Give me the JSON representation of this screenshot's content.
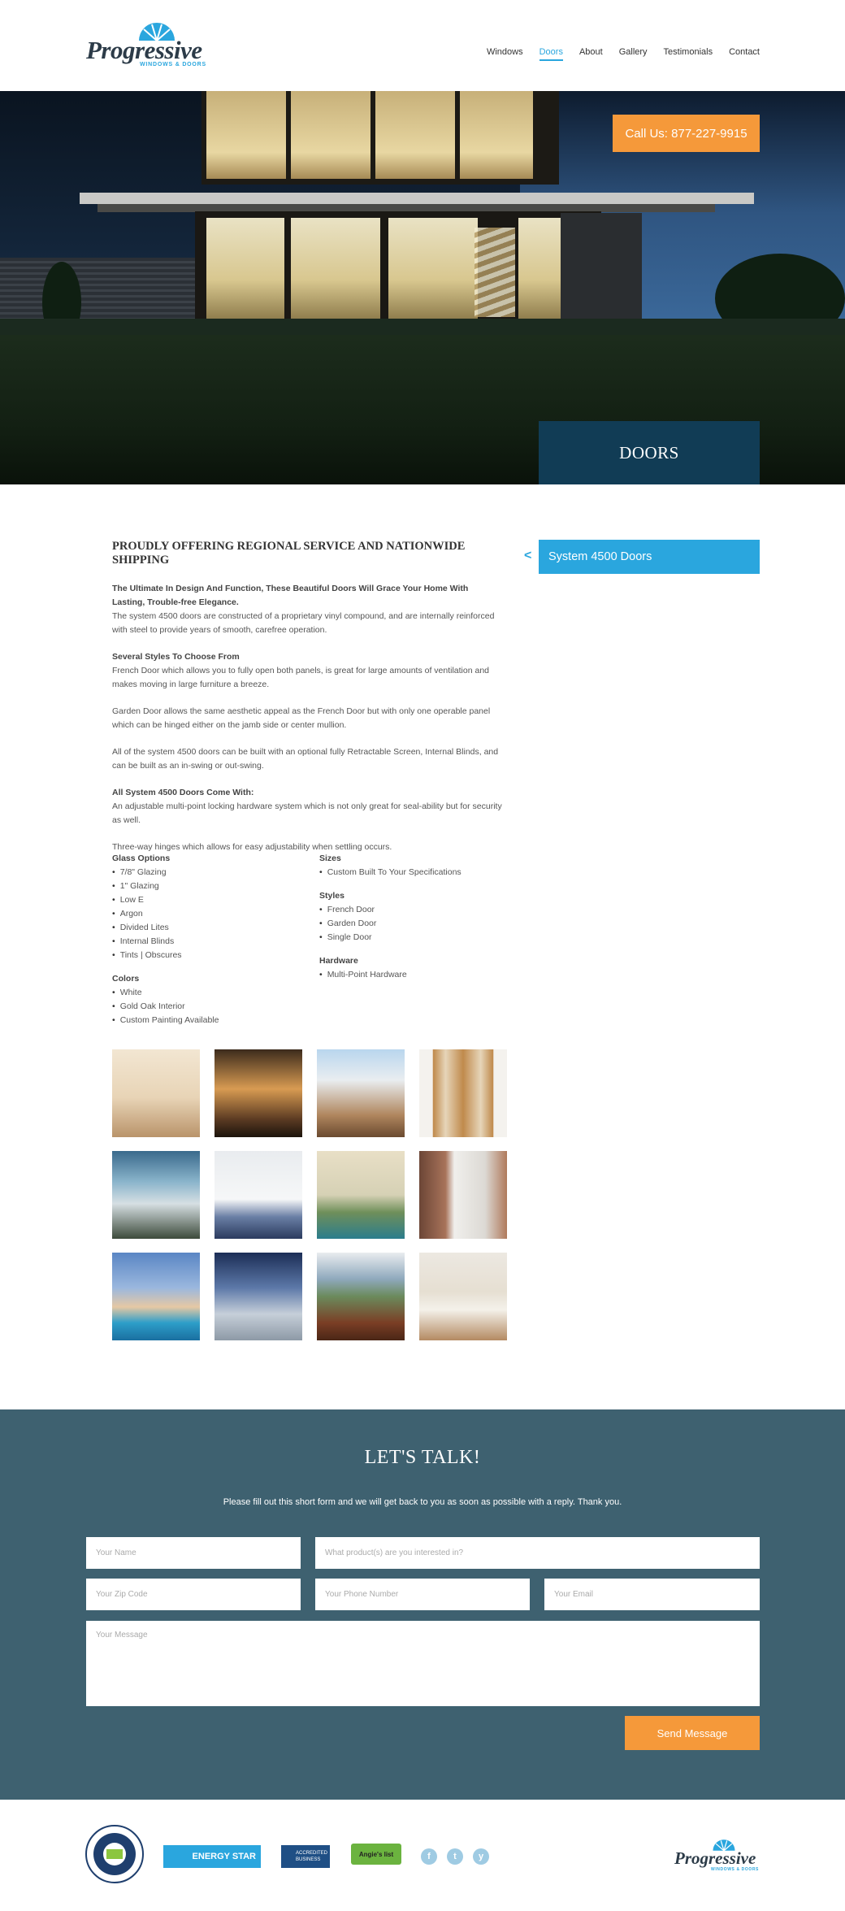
{
  "header": {
    "logo_text": "Progressive",
    "logo_sub": "WINDOWS & DOORS",
    "nav": [
      "Windows",
      "Doors",
      "About",
      "Gallery",
      "Testimonials",
      "Contact"
    ],
    "active_nav": "Doors"
  },
  "hero": {
    "cta": "Call Us: 877-227-9915",
    "page_label": "DOORS"
  },
  "sidebar": {
    "back_icon": "<",
    "item": "System 4500 Doors"
  },
  "content": {
    "title": "PROUDLY OFFERING REGIONAL SERVICE AND NATIONWIDE SHIPPING",
    "p1_bold": "The Ultimate In Design And Function, These Beautiful Doors Will Grace Your Home With Lasting, Trouble-free Elegance.",
    "p1_text": "The system 4500 doors are constructed of a proprietary vinyl compound, and are internally reinforced with steel to provide years of smooth, carefree operation.",
    "p2_bold": "Several Styles To Choose From",
    "p2_text": "French Door which allows you to fully open both panels, is great for large amounts of ventilation and makes moving in large furniture a breeze.",
    "p3_text": "Garden Door allows the same aesthetic appeal as the French Door but with only one operable panel which can be hinged either on the jamb side or center mullion.",
    "p4_text": "All of the system 4500 doors can be built with an optional fully Retractable Screen, Internal Blinds, and can be built as an in-swing or out-swing.",
    "p5_bold": "All System 4500 Doors Come With:",
    "p5_text": "An adjustable multi-point locking hardware system which is not only great for seal-ability but for security as well.",
    "p6_text": "Three-way hinges which allows for easy adjustability when settling occurs."
  },
  "specs": {
    "glass": {
      "heading": "Glass Options",
      "items": [
        "7/8\" Glazing",
        "1\" Glazing",
        "Low E",
        "Argon",
        "Divided Lites",
        "Internal Blinds",
        "Tints | Obscures"
      ]
    },
    "colors": {
      "heading": "Colors",
      "items": [
        "White",
        "Gold Oak Interior",
        "Custom Painting Available"
      ]
    },
    "sizes": {
      "heading": "Sizes",
      "items": [
        "Custom Built To Your Specifications"
      ]
    },
    "styles": {
      "heading": "Styles",
      "items": [
        "French Door",
        "Garden Door",
        "Single Door"
      ]
    },
    "hardware": {
      "heading": "Hardware",
      "items": [
        "Multi-Point Hardware"
      ]
    }
  },
  "contact": {
    "title": "LET'S TALK!",
    "subtitle": "Please fill out this short form and we will get back to you as soon as possible with a reply. Thank you.",
    "name_placeholder": "Your Name",
    "product_placeholder": "What product(s) are you interested in?",
    "zip_placeholder": "Your Zip Code",
    "phone_placeholder": "Your Phone Number",
    "email_placeholder": "Your Email",
    "message_placeholder": "Your Message",
    "send_label": "Send Message"
  },
  "footer": {
    "badge_energy": "ENERGY STAR",
    "badge_bbb_1": "ACCREDITED",
    "badge_bbb_2": "BUSINESS",
    "badge_angie": "Angie's list",
    "social": [
      "f",
      "t",
      "y"
    ],
    "logo_text": "Progressive",
    "logo_sub": "WINDOWS & DOORS"
  },
  "colors": {
    "accent_blue": "#2aa6de",
    "orange": "#f5993a",
    "navy": "#113c55",
    "contact_bg": "#3e6170"
  }
}
